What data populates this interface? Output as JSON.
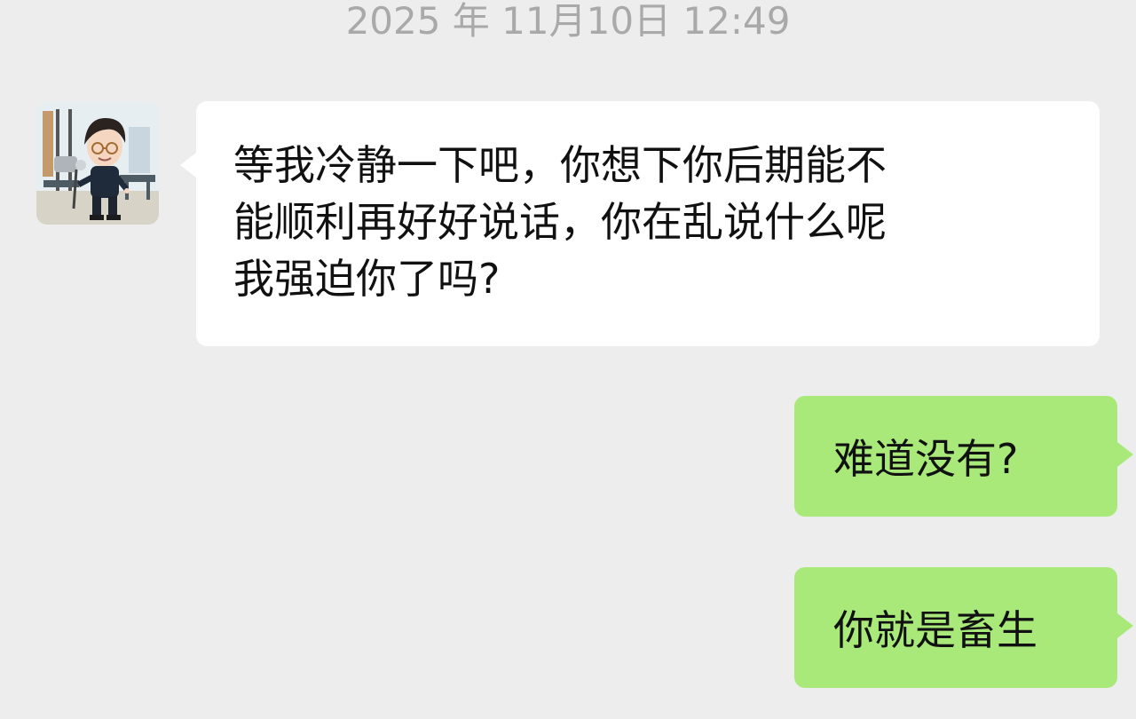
{
  "chat": {
    "timestamp": "2025 年 11月10日 12:49",
    "messages": [
      {
        "sender": "contact",
        "lines": [
          "等我冷静一下吧，你想下你后期能不",
          "能顺利再好好说话，你在乱说什么呢",
          "我强迫你了吗?"
        ]
      },
      {
        "sender": "self",
        "text": "难道没有?"
      },
      {
        "sender": "self",
        "text": "你就是畜生"
      }
    ]
  },
  "colors": {
    "background": "#ededed",
    "incoming_bubble": "#ffffff",
    "outgoing_bubble": "#a9e97a",
    "timestamp_text": "#a9a9a9"
  },
  "icons": {
    "avatar": "cartoon-avatar-icon"
  }
}
